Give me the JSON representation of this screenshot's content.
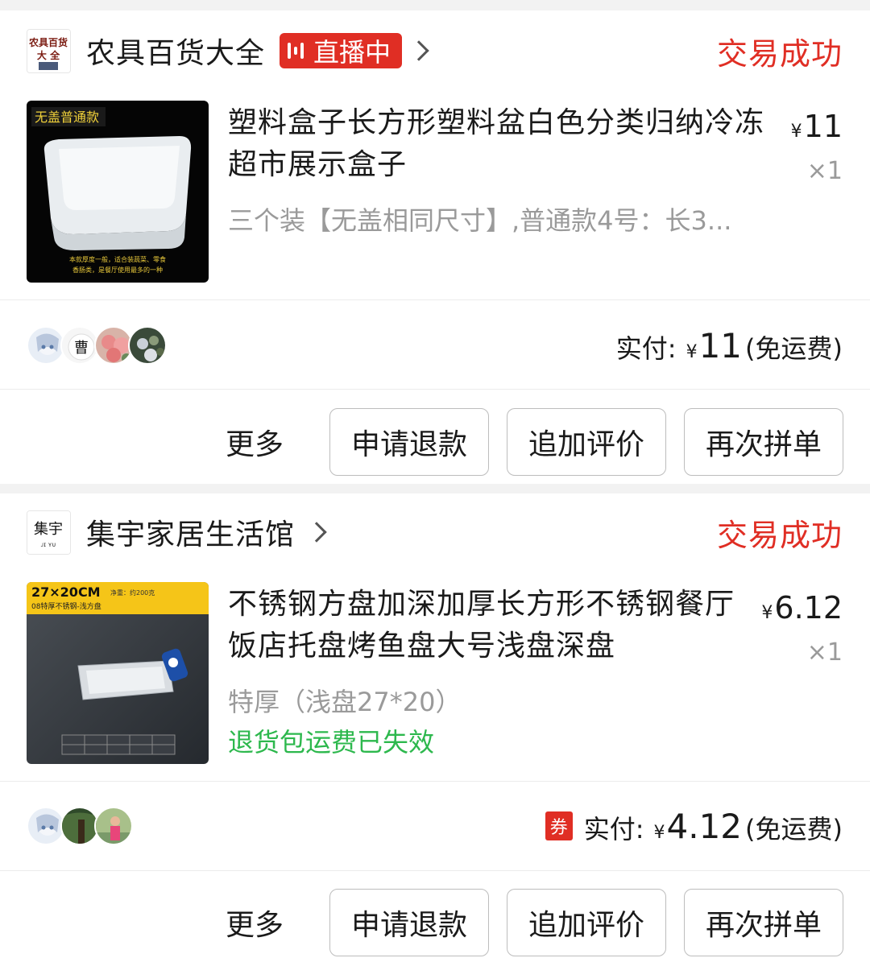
{
  "orders": [
    {
      "shop_name": "农具百货大全",
      "shop_logo_text": "农具百货大全",
      "live_label": "直播中",
      "status": "交易成功",
      "product_title": "塑料盒子长方形塑料盆白色分类归纳冷冻超市展示盒子",
      "thumb_tag": "无盖普通款",
      "spec": "三个装【无盖相同尺寸】,普通款4号：长3...",
      "price": "11",
      "currency": "¥",
      "qty": "×1",
      "paid_label": "实付:",
      "paid_amount": "11",
      "shipping": "(免运费)",
      "more": "更多",
      "btn_refund": "申请退款",
      "btn_review": "追加评价",
      "btn_reorder": "再次拼单"
    },
    {
      "shop_name": "集宇家居生活馆",
      "shop_logo_text": "集宇",
      "status": "交易成功",
      "product_title": "不锈钢方盘加深加厚长方形不锈钢餐厅饭店托盘烤鱼盘大号浅盘深盘",
      "thumb_size": "27×20CM",
      "thumb_sub": "08特厚不锈钢-浅方盘",
      "thumb_weight": "净重：约200克",
      "spec": "特厚（浅盘27*20）",
      "notice": "退货包运费已失效",
      "price": "6.12",
      "currency": "¥",
      "qty": "×1",
      "coupon": "券",
      "paid_label": "实付:",
      "paid_amount": "4.12",
      "shipping": "(免运费)",
      "more": "更多",
      "btn_refund": "申请退款",
      "btn_review": "追加评价",
      "btn_reorder": "再次拼单"
    }
  ]
}
